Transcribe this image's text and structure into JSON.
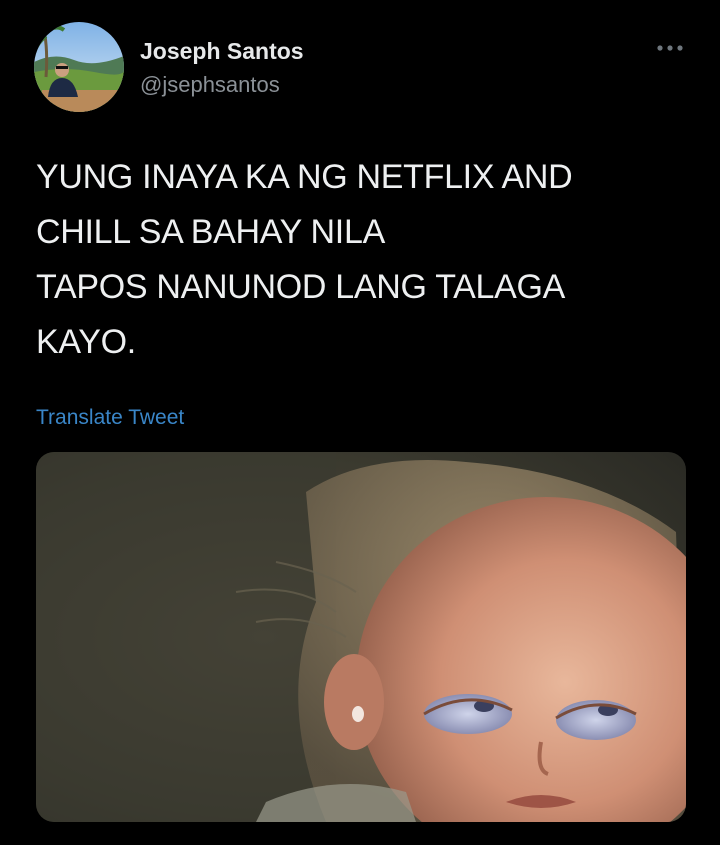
{
  "author": {
    "display_name": "Joseph Santos",
    "handle": "@jsephsantos"
  },
  "icons": {
    "more": "more-horizontal-icon"
  },
  "tweet": {
    "lines": [
      "YUNG INAYA KA NG NETFLIX AND",
      "CHILL SA BAHAY NILA",
      "TAPOS NANUNOD LANG TALAGA",
      "KAYO."
    ],
    "translate_label": "Translate Tweet"
  },
  "colors": {
    "background": "#000000",
    "text": "#e7e9ea",
    "secondary_text": "#8b9197",
    "link": "#3a86c8"
  }
}
